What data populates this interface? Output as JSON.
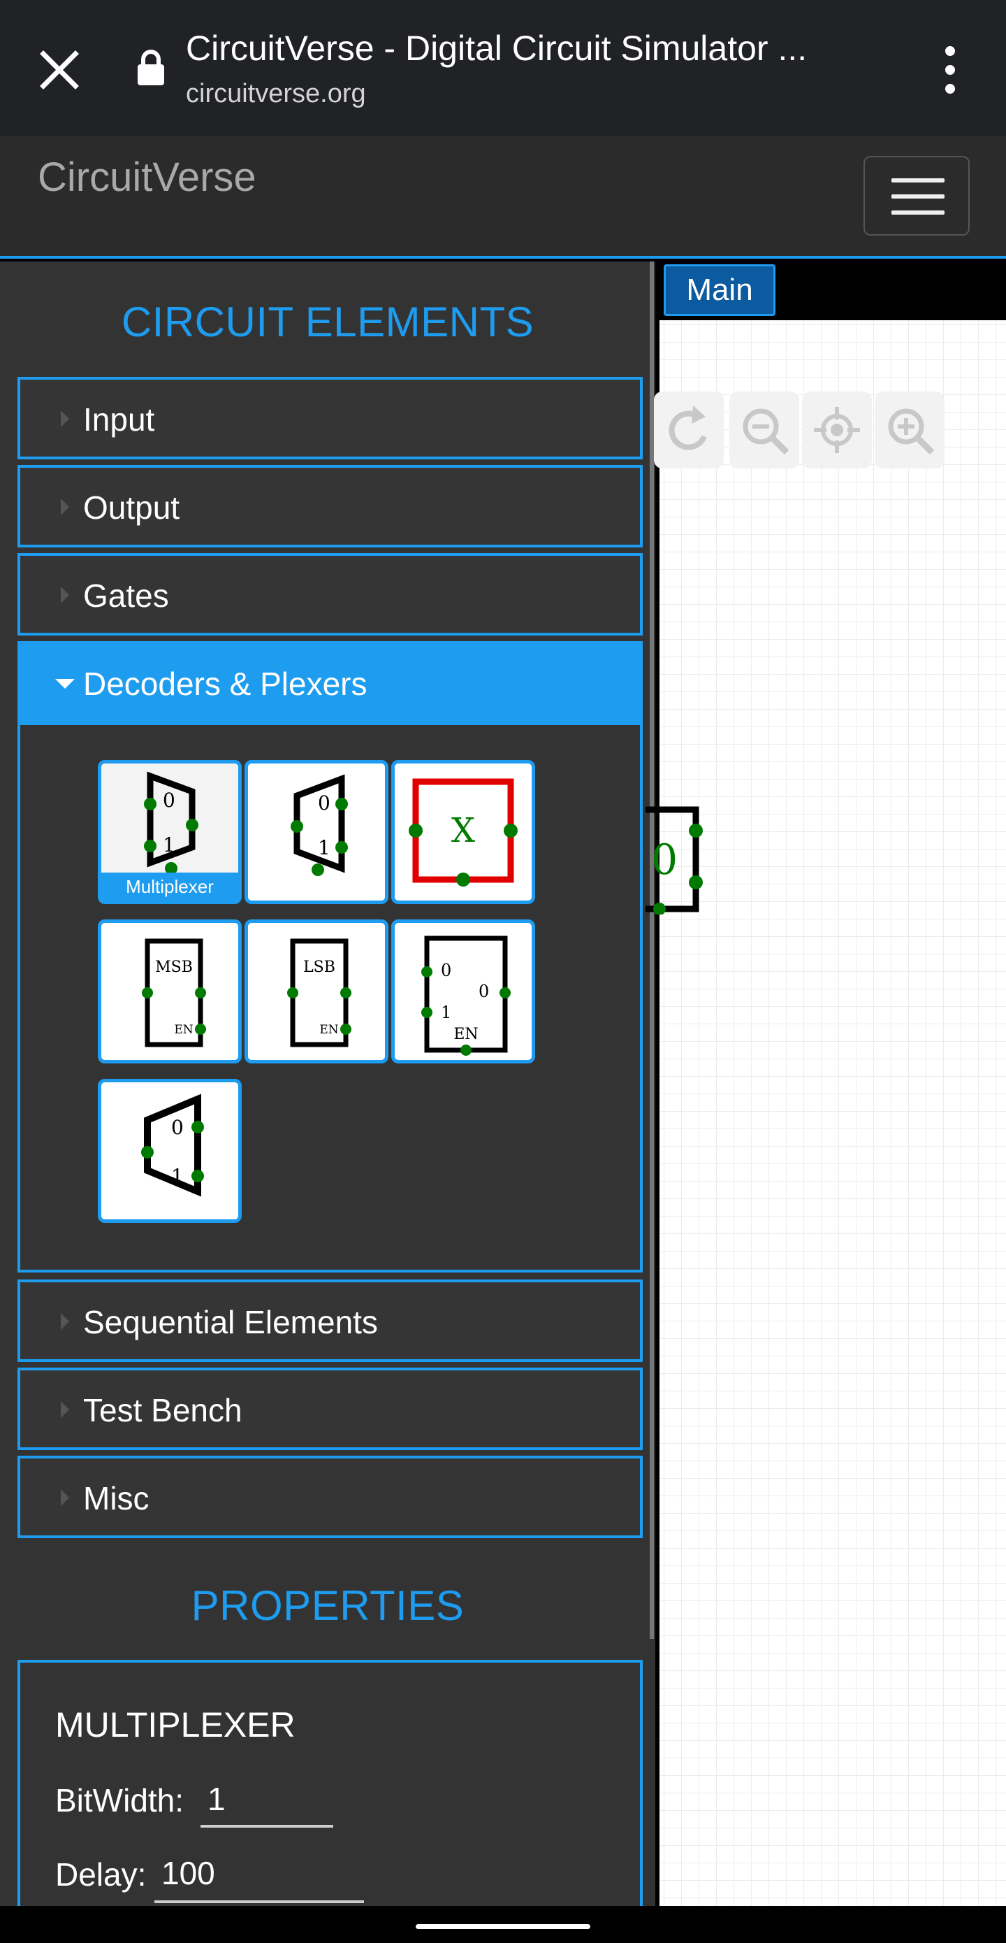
{
  "browser": {
    "title": "CircuitVerse - Digital Circuit Simulator ...",
    "url": "circuitverse.org",
    "close_icon": "close-icon",
    "lock_icon": "lock-icon",
    "menu_icon": "more-vert-icon"
  },
  "header": {
    "brand": "CircuitVerse",
    "menu_icon": "hamburger-icon"
  },
  "sidebar": {
    "heading": "CIRCUIT ELEMENTS",
    "categories": [
      {
        "label": "Input",
        "expanded": false
      },
      {
        "label": "Output",
        "expanded": false
      },
      {
        "label": "Gates",
        "expanded": false
      },
      {
        "label": "Decoders & Plexers",
        "expanded": true
      },
      {
        "label": "Sequential Elements",
        "expanded": false
      },
      {
        "label": "Test Bench",
        "expanded": false
      },
      {
        "label": "Misc",
        "expanded": false
      }
    ],
    "decoders_elements": [
      {
        "icon": "multiplexer-icon",
        "caption": "Multiplexer",
        "selected": true
      },
      {
        "icon": "demultiplexer-icon",
        "selected": false
      },
      {
        "icon": "bit-selector-icon",
        "text": "X",
        "selected": false
      },
      {
        "icon": "msb-icon",
        "text": "MSB",
        "sub": "EN",
        "selected": false
      },
      {
        "icon": "lsb-icon",
        "text": "LSB",
        "sub": "EN",
        "selected": false
      },
      {
        "icon": "priority-encoder-icon",
        "text_a": "0",
        "text_b": "1",
        "text_c": "0",
        "sub": "EN",
        "selected": false
      },
      {
        "icon": "decoder-icon",
        "text_a": "0",
        "text_b": "1",
        "selected": false
      }
    ],
    "mux_labels": {
      "zero": "0",
      "one": "1"
    }
  },
  "properties": {
    "heading": "PROPERTIES",
    "element_name": "MULTIPLEXER",
    "bitwidth_label": "BitWidth:",
    "bitwidth_value": "1",
    "delay_label": "Delay:",
    "delay_value": "100"
  },
  "canvas": {
    "tab_label": "Main",
    "tools": [
      "undo-icon",
      "zoom-out-icon",
      "center-focus-icon",
      "zoom-in-icon"
    ],
    "partial_digit": "0"
  },
  "colors": {
    "accent": "#1e9cf0",
    "panel": "#333333",
    "node": "#007a00",
    "bit_selector_border": "#e00000"
  }
}
